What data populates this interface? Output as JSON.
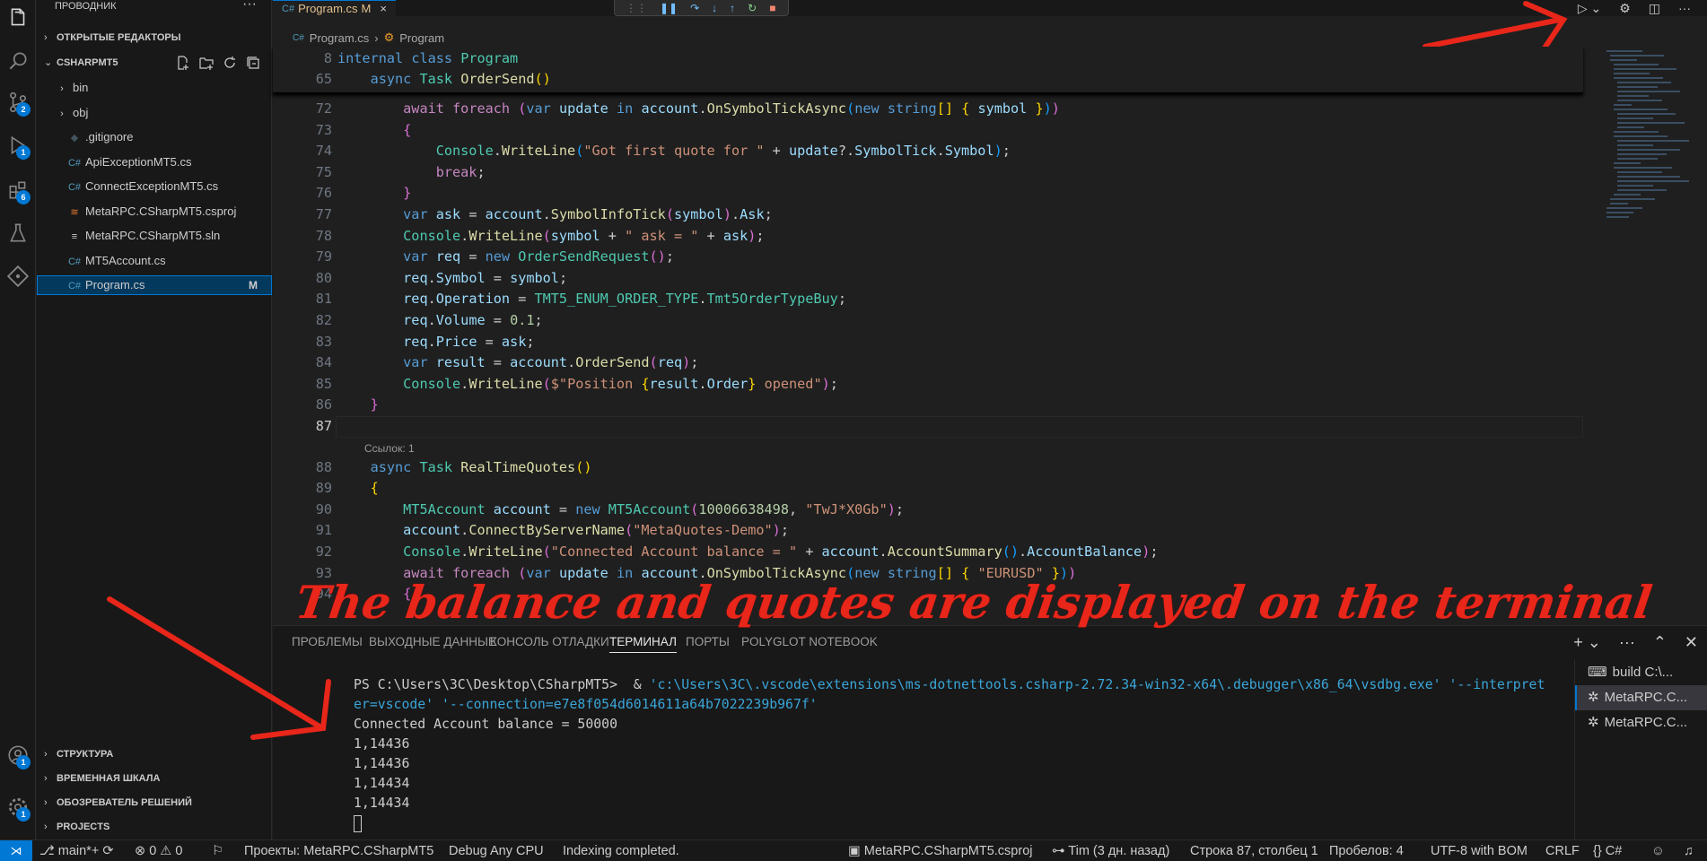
{
  "sidebar": {
    "title": "ПРОВОДНИК",
    "sections": {
      "open_editors": "ОТКРЫТЫЕ РЕДАКТОРЫ",
      "project": "CSHARPMT5",
      "outline": "СТРУКТУРА",
      "timeline": "ВРЕМЕННАЯ ШКАЛА",
      "solution": "ОБОЗРЕВАТЕЛЬ РЕШЕНИЙ",
      "projects": "PROJECTS"
    },
    "tree": [
      {
        "label": "bin",
        "kind": "folder"
      },
      {
        "label": "obj",
        "kind": "folder"
      },
      {
        "label": ".gitignore",
        "kind": "git"
      },
      {
        "label": "ApiExceptionMT5.cs",
        "kind": "cs"
      },
      {
        "label": "ConnectExceptionMT5.cs",
        "kind": "cs"
      },
      {
        "label": "MetaRPC.CSharpMT5.csproj",
        "kind": "rss"
      },
      {
        "label": "MetaRPC.CSharpMT5.sln",
        "kind": "sln"
      },
      {
        "label": "MT5Account.cs",
        "kind": "cs"
      },
      {
        "label": "Program.cs",
        "kind": "cs",
        "flag": "M"
      }
    ]
  },
  "activity": {
    "badges": {
      "scm": "2",
      "debug": "1",
      "extensions": "6",
      "accounts": "1",
      "settings": "1"
    }
  },
  "editor": {
    "tab": {
      "label": "Program.cs",
      "flag": "M",
      "close": "×"
    },
    "breadcrumb": {
      "file": "Program.cs",
      "symbol": "Program"
    },
    "codelens": "Ссылок: 1"
  },
  "panel": {
    "tabs": [
      "ПРОБЛЕМЫ",
      "ВЫХОДНЫЕ ДАННЫЕ",
      "КОНСОЛЬ ОТЛАДКИ",
      "ТЕРМИНАЛ",
      "ПОРТЫ",
      "POLYGLOT NOTEBOOK"
    ],
    "active_tab": "ТЕРМИНАЛ",
    "terminal_prompt": "PS C:\\Users\\3C\\Desktop\\CSharpMT5>  & ",
    "terminal_cmd1": "'c:\\Users\\3C\\.vscode\\extensions\\ms-dotnettools.csharp-2.72.34-win32-x64\\.debugger\\x86_64\\vsdbg.exe' '--interpret",
    "terminal_cmd2": "er=vscode' '--connection=e7e8f054d6014611a64b7022239b967f'",
    "output": [
      "Connected Account balance = 50000",
      "1,14436",
      "1,14436",
      "1,14434",
      "1,14434"
    ],
    "terminals": [
      "build C:\\...",
      "MetaRPC.C...",
      "MetaRPC.C..."
    ]
  },
  "statusbar": {
    "branch": "main*+",
    "errors": "0",
    "warnings": "0",
    "projects": "Проекты: MetaRPC.CSharpMT5",
    "config": "Debug Any CPU",
    "indexing": "Indexing completed.",
    "csproj": "MetaRPC.CSharpMT5.csproj",
    "blame": "Tim (3 дн. назад)",
    "position": "Строка 87, столбец 1",
    "spaces": "Пробелов: 4",
    "encoding": "UTF-8 with BOM",
    "eol": "CRLF",
    "language": "C#"
  },
  "annotation": {
    "text": "The balance and quotes are displayed on the terminal",
    "color": "#e8261a"
  }
}
